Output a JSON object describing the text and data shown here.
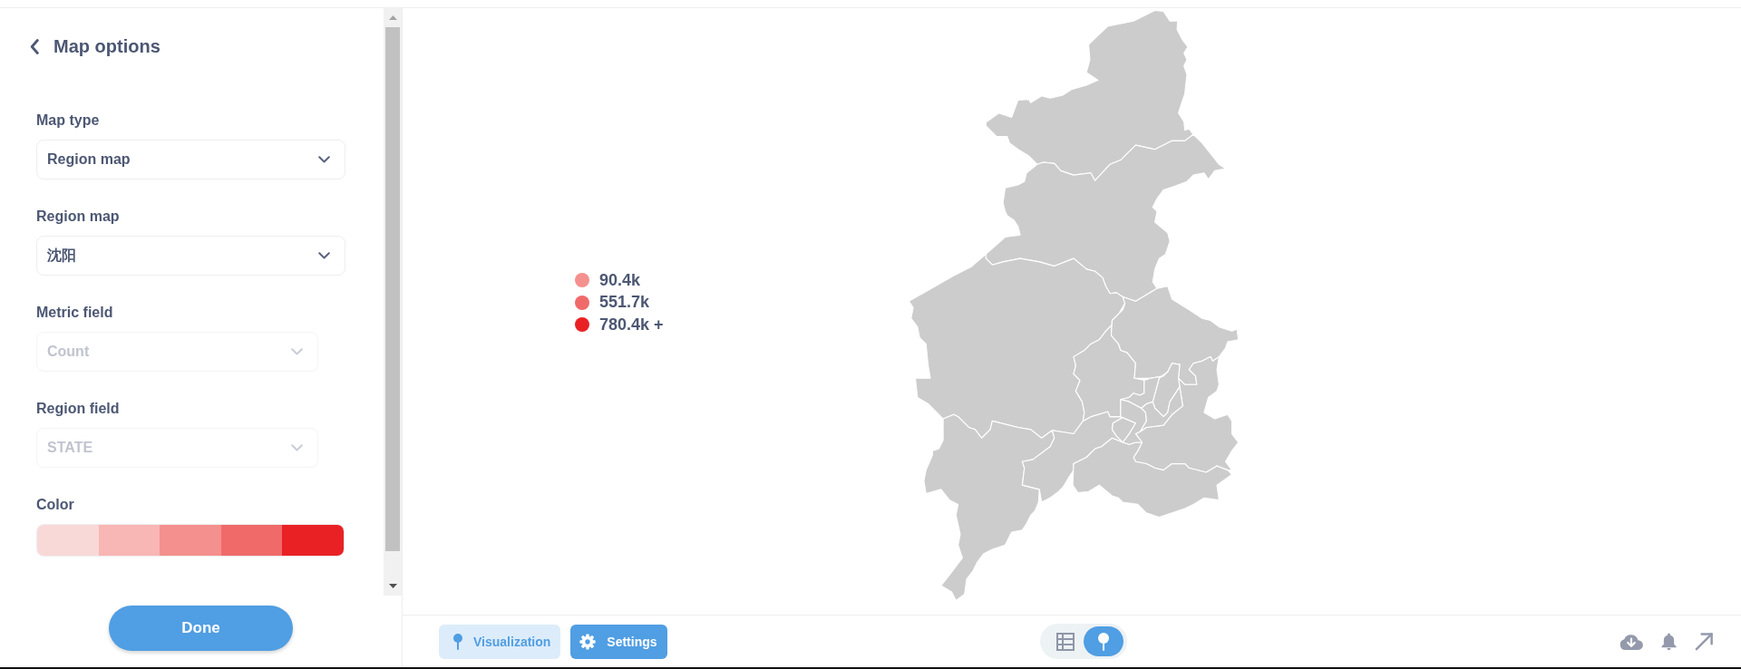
{
  "sidebar": {
    "title": "Map options",
    "fields": [
      {
        "label": "Map type",
        "value": "Region map",
        "disabled": false
      },
      {
        "label": "Region map",
        "value": "沈阳",
        "disabled": false
      },
      {
        "label": "Metric field",
        "value": "Count",
        "disabled": true
      },
      {
        "label": "Region field",
        "value": "STATE",
        "disabled": true
      }
    ],
    "color": {
      "label": "Color",
      "swatches": [
        {
          "color": "#f9d9d8"
        },
        {
          "color": "#f8b6b4"
        },
        {
          "color": "#f4908e"
        },
        {
          "color": "#f06a6a"
        },
        {
          "color": "#e92124"
        }
      ]
    },
    "done_button": "Done"
  },
  "legend": [
    {
      "label": "90.4k",
      "color": "#f4908e"
    },
    {
      "label": "551.7k",
      "color": "#f06a6a"
    },
    {
      "label": "780.4k +",
      "color": "#e92124"
    }
  ],
  "footer": {
    "visualization_button": {
      "label": "Visualization",
      "selected": false
    },
    "settings_button": {
      "label": "Settings",
      "selected": true
    },
    "view_toggle": [
      {
        "kind": "table",
        "selected": false
      },
      {
        "kind": "map",
        "selected": true
      }
    ]
  }
}
